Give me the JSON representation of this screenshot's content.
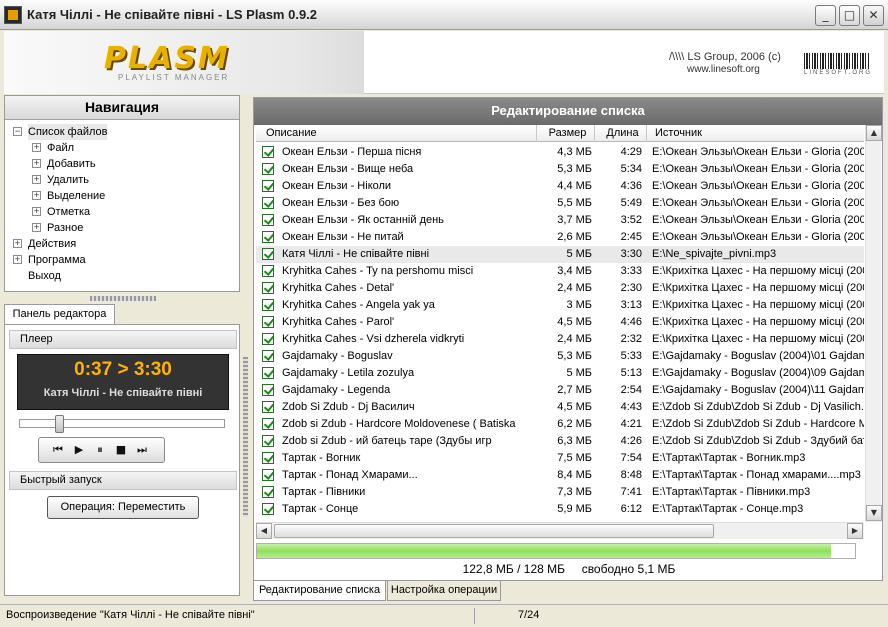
{
  "window": {
    "title": "Катя Чіллі - Не співайте півні - LS Plasm 0.9.2"
  },
  "banner": {
    "logo": "PLASM",
    "logo_sub": "PLAYLIST MANAGER",
    "copyright": "/\\\\\\\\ LS Group, 2006 (c)",
    "url": "www.linesoft.org",
    "barcode_text": "LINESOFT.ORG"
  },
  "nav": {
    "header": "Навигация",
    "items": [
      {
        "label": "Список файлов",
        "level": 0,
        "expander": "−",
        "selected": true
      },
      {
        "label": "Файл",
        "level": 1,
        "expander": "+"
      },
      {
        "label": "Добавить",
        "level": 1,
        "expander": "+"
      },
      {
        "label": "Удалить",
        "level": 1,
        "expander": "+"
      },
      {
        "label": "Выделение",
        "level": 1,
        "expander": "+"
      },
      {
        "label": "Отметка",
        "level": 1,
        "expander": "+"
      },
      {
        "label": "Разное",
        "level": 1,
        "expander": "+"
      },
      {
        "label": "Действия",
        "level": 0,
        "expander": "+"
      },
      {
        "label": "Программа",
        "level": 0,
        "expander": "+"
      },
      {
        "label": "Выход",
        "level": 0,
        "expander": ""
      }
    ]
  },
  "editor": {
    "tab": "Панель редактора",
    "player_section": "Плеер",
    "time": "0:37 > 3:30",
    "track": "Катя Чіллі - Не співайте півні",
    "seek_fraction": 0.18,
    "quick_section": "Быстрый запуск",
    "operation_button": "Операция: Переместить"
  },
  "list": {
    "header": "Редактирование списка",
    "columns": {
      "desc": "Описание",
      "size": "Размер",
      "length": "Длина",
      "source": "Источник"
    },
    "rows": [
      {
        "desc": "Океан Ельзи - Перша пісня",
        "size": "4,3 МБ",
        "len": "4:29",
        "src": "E:\\Океан Эльзы\\Океан Ельзи - Gloria (200"
      },
      {
        "desc": "Океан Ельзи - Вище неба",
        "size": "5,3 МБ",
        "len": "5:34",
        "src": "E:\\Океан Эльзы\\Океан Ельзи - Gloria (200"
      },
      {
        "desc": "Океан Ельзи - Ніколи",
        "size": "4,4 МБ",
        "len": "4:36",
        "src": "E:\\Океан Эльзы\\Океан Ельзи - Gloria (200"
      },
      {
        "desc": "Океан Ельзи - Без бою",
        "size": "5,5 МБ",
        "len": "5:49",
        "src": "E:\\Океан Эльзы\\Океан Ельзи - Gloria (200"
      },
      {
        "desc": "Океан Ельзи - Як останній день",
        "size": "3,7 МБ",
        "len": "3:52",
        "src": "E:\\Океан Эльзы\\Океан Ельзи - Gloria (200"
      },
      {
        "desc": "Океан Ельзи - Не питай",
        "size": "2,6 МБ",
        "len": "2:45",
        "src": "E:\\Океан Эльзы\\Океан Ельзи - Gloria (200"
      },
      {
        "desc": "Катя Чіллі - Не співайте півні",
        "size": "5 МБ",
        "len": "3:30",
        "src": "E:\\Ne_spivajte_pivni.mp3",
        "playing": true
      },
      {
        "desc": "Kryhitka Cahes - Ty na pershomu misci",
        "size": "3,4 МБ",
        "len": "3:33",
        "src": "E:\\Крихітка Цахес - На першому місці (200"
      },
      {
        "desc": "Kryhitka Cahes - Detal'",
        "size": "2,4 МБ",
        "len": "2:30",
        "src": "E:\\Крихітка Цахес - На першому місці (200"
      },
      {
        "desc": "Kryhitka Cahes - Angela yak ya",
        "size": "3 МБ",
        "len": "3:13",
        "src": "E:\\Крихітка Цахес - На першому місці (200"
      },
      {
        "desc": "Kryhitka Cahes - Parol'",
        "size": "4,5 МБ",
        "len": "4:46",
        "src": "E:\\Крихітка Цахес - На першому місці (200"
      },
      {
        "desc": "Kryhitka Cahes - Vsi dzherela vidkryti",
        "size": "2,4 МБ",
        "len": "2:32",
        "src": "E:\\Крихітка Цахес - На першому місці (200"
      },
      {
        "desc": "Gajdamaky - Boguslav",
        "size": "5,3 МБ",
        "len": "5:33",
        "src": "E:\\Gajdamaky - Boguslav (2004)\\01 Gajdam"
      },
      {
        "desc": "Gajdamaky - Letila zozulya",
        "size": "5 МБ",
        "len": "5:13",
        "src": "E:\\Gajdamaky - Boguslav (2004)\\09 Gajdam"
      },
      {
        "desc": "Gajdamaky - Legenda",
        "size": "2,7 МБ",
        "len": "2:54",
        "src": "E:\\Gajdamaky - Boguslav (2004)\\11 Gajdam"
      },
      {
        "desc": "Zdob Si Zdub - Dj Василич",
        "size": "4,5 МБ",
        "len": "4:43",
        "src": "E:\\Zdob Si Zdub\\Zdob Si Zdub - Dj Vasilich.m"
      },
      {
        "desc": "Zdob si Zdub - Hardcore Moldovenese ( Batiska",
        "size": "6,2 МБ",
        "len": "4:21",
        "src": "E:\\Zdob Si Zdub\\Zdob Si Zdub - Hardcore M"
      },
      {
        "desc": "Zdob si Zdub - ий батець таре (Здубы игр",
        "size": "6,3 МБ",
        "len": "4:26",
        "src": "E:\\Zdob Si Zdub\\Zdob Si Zdub - Здубий бат"
      },
      {
        "desc": "Тартак - Вогник",
        "size": "7,5 МБ",
        "len": "7:54",
        "src": "E:\\Тартак\\Тартак - Вогник.mp3"
      },
      {
        "desc": "Тартак - Понад Хмарами...",
        "size": "8,4 МБ",
        "len": "8:48",
        "src": "E:\\Тартак\\Тартак - Понад хмарами....mp3"
      },
      {
        "desc": "Тартак - Півники",
        "size": "7,3 МБ",
        "len": "7:41",
        "src": "E:\\Тартак\\Тартак - Півники.mp3"
      },
      {
        "desc": "Тартак - Сонце",
        "size": "5,9 МБ",
        "len": "6:12",
        "src": "E:\\Тартак\\Тартак - Сонце.mp3"
      }
    ],
    "usage_fraction": 0.96,
    "memory_text": "122,8 МБ / 128 МБ     свободно 5,1 МБ"
  },
  "bottom_tabs": [
    "Редактирование списка",
    "Настройка операции"
  ],
  "status": {
    "text": "Воспроизведение \"Катя Чіллі - Не співайте півні\"",
    "count": "7/24"
  },
  "colors": {
    "accent_time": "#ffb300",
    "progress": "#8ee05c",
    "header_bg": "#6a6a6a"
  }
}
